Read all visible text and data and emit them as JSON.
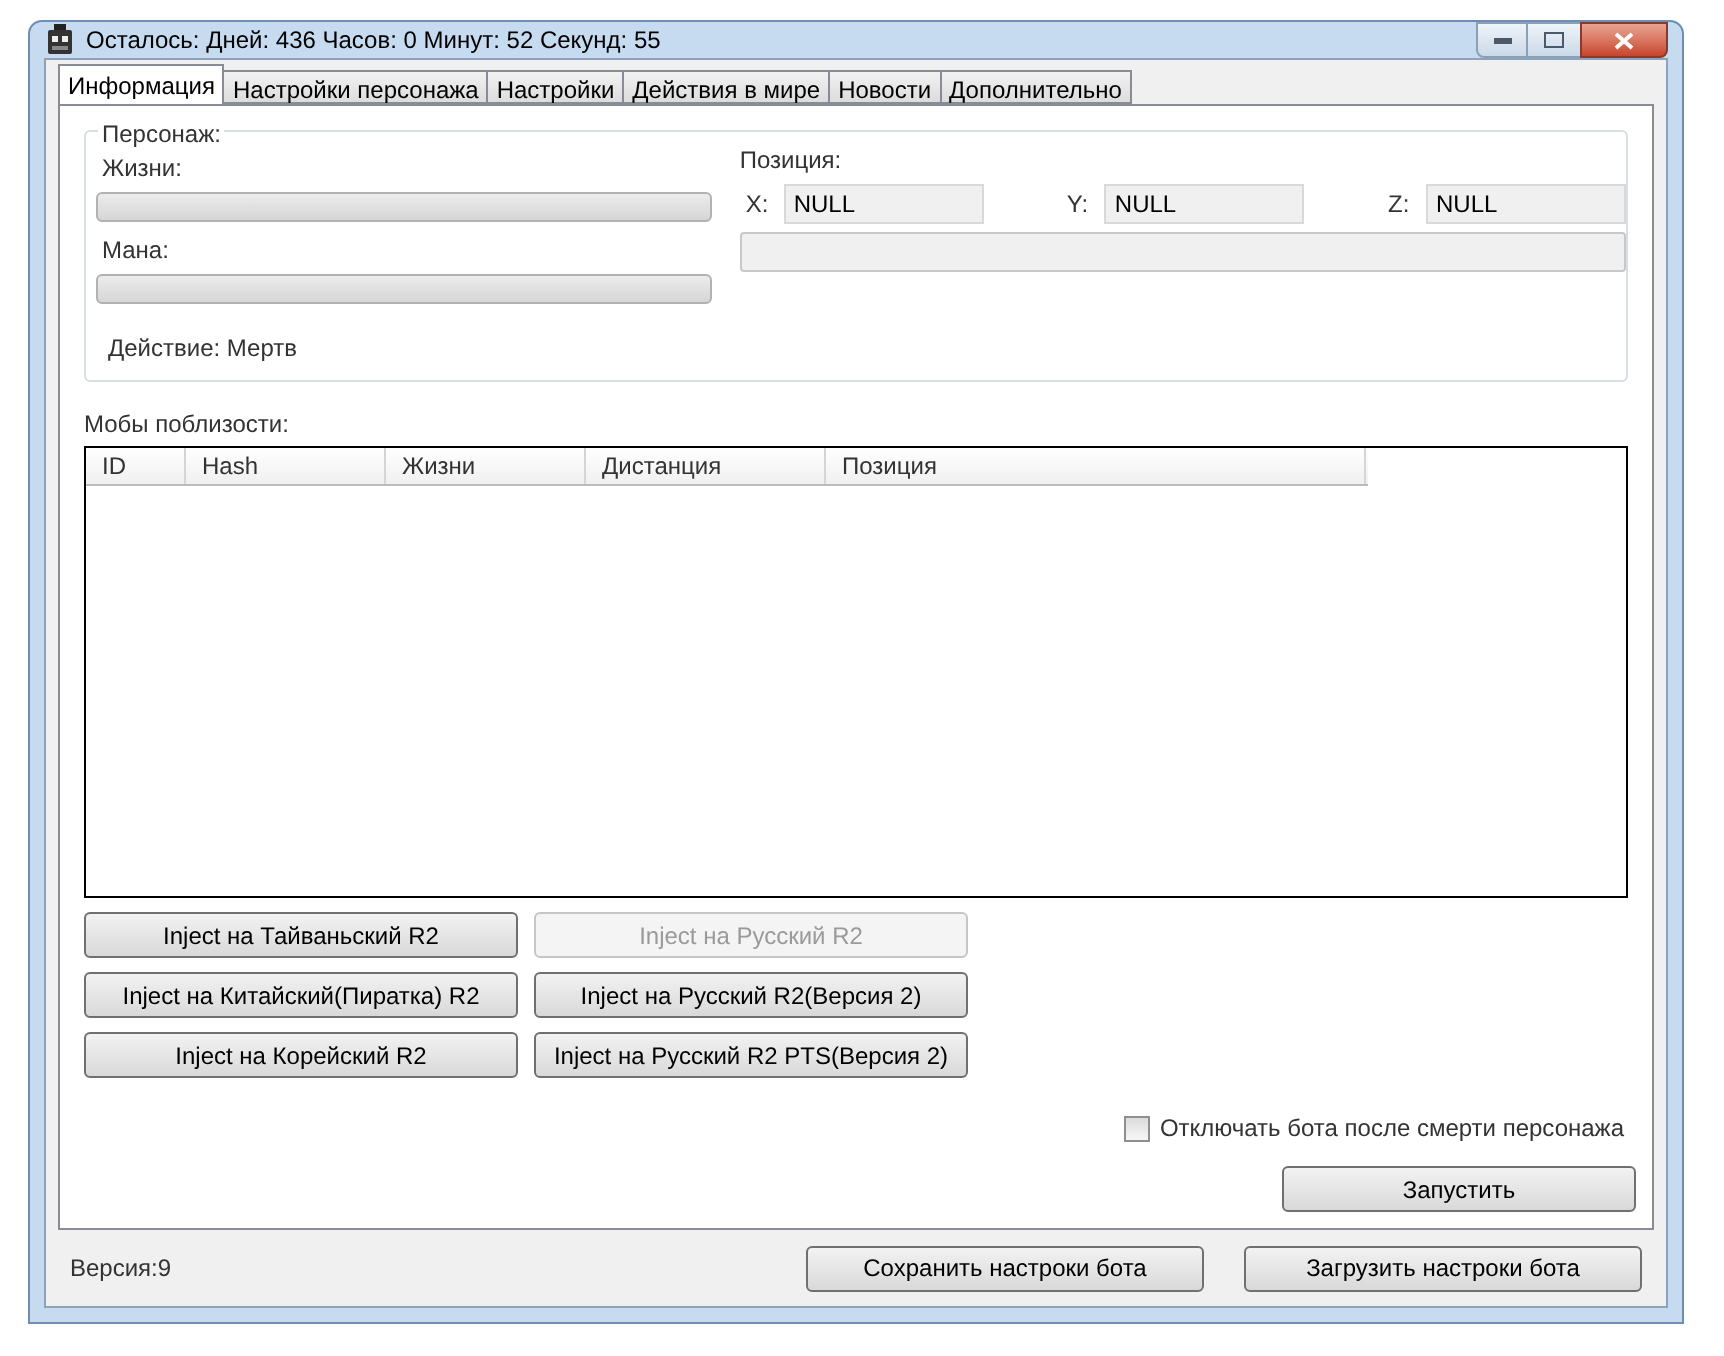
{
  "window": {
    "title": "Осталось: Дней: 436 Часов: 0 Минут: 52 Секунд: 55"
  },
  "tabs": [
    {
      "label": "Информация",
      "selected": true
    },
    {
      "label": "Настройки персонажа",
      "selected": false
    },
    {
      "label": "Настройки",
      "selected": false
    },
    {
      "label": "Действия в мире",
      "selected": false
    },
    {
      "label": "Новости",
      "selected": false
    },
    {
      "label": "Дополнительно",
      "selected": false
    }
  ],
  "character": {
    "title": "Персонаж:",
    "bars": [
      {
        "label": "Жизни:",
        "level": 0
      },
      {
        "label": "Мана:",
        "level": 0
      }
    ],
    "action": "Действие: Мертв"
  },
  "position": {
    "title": "Позиция:",
    "coords": [
      {
        "label": "X:",
        "value": "NULL"
      },
      {
        "label": "Y:",
        "value": "NULL"
      },
      {
        "label": "Z:",
        "value": "NULL"
      }
    ]
  },
  "mobs": {
    "title": "Мобы поблизости:",
    "columns": [
      "ID",
      "Hash",
      "Жизни",
      "Дистанция",
      "Позиция"
    ]
  },
  "inject_buttons": [
    {
      "label": "Inject на Тайваньский R2",
      "disabled": false
    },
    {
      "label": "Inject на Русский R2",
      "disabled": true
    },
    {
      "label": "Inject на Китайский(Пиратка) R2",
      "disabled": false
    },
    {
      "label": "Inject на Русский R2(Версия 2)",
      "disabled": false
    },
    {
      "label": "Inject на Корейский R2",
      "disabled": false
    },
    {
      "label": "Inject на Русский R2 PTS(Версия 2)",
      "disabled": false
    }
  ],
  "stop_on_death": {
    "label": "Отключать бота после смерти персонажа",
    "checked": false
  },
  "start_button": "Запустить",
  "version": "Версия:9",
  "bottom_buttons": [
    "Сохранить настроки бота",
    "Загрузить настроки бота"
  ]
}
